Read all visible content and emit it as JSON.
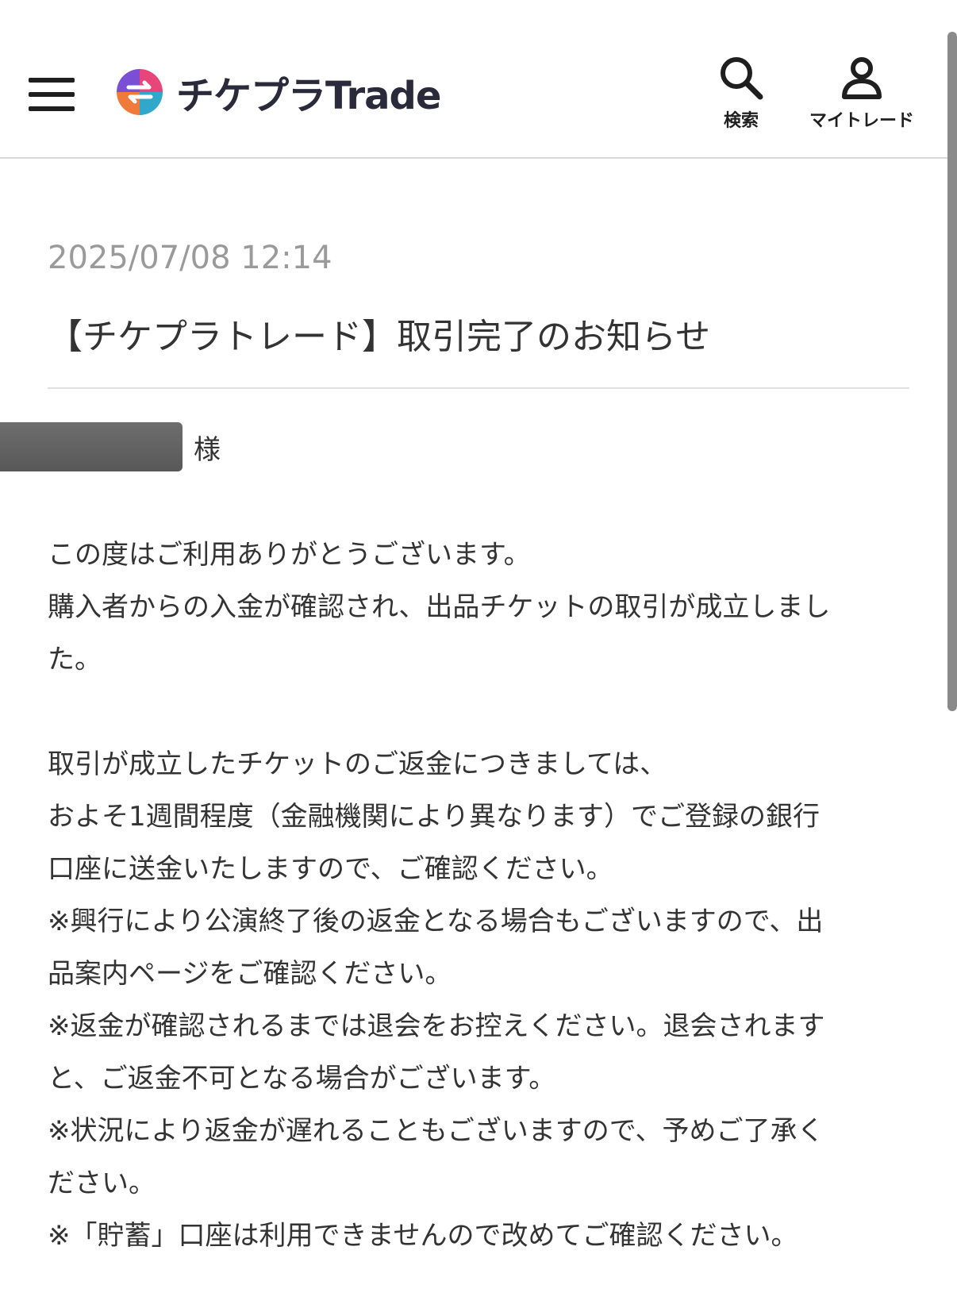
{
  "header": {
    "logo_text": "チケプラTrade",
    "search_label": "検索",
    "mytrade_label": "マイトレード"
  },
  "message": {
    "date": "2025/07/08 12:14",
    "subject": "【チケプラトレード】取引完了のお知らせ",
    "honorific": "様",
    "lines": [
      "この度はご利用ありがとうございます。",
      "購入者からの入金が確認され、出品チケットの取引が成立しまし",
      "た。",
      "",
      "取引が成立したチケットのご返金につきましては、",
      "およそ1週間程度（金融機関により異なります）でご登録の銀行",
      "口座に送金いたしますので、ご確認ください。",
      "※興行により公演終了後の返金となる場合もございますので、出",
      "品案内ページをご確認ください。",
      "※返金が確認されるまでは退会をお控えください。退会されます",
      "と、ご返金不可となる場合がございます。",
      "※状況により返金が遅れることもございますので、予めご了承く",
      "ださい。",
      "※「貯蓄」口座は利用できませんので改めてご確認ください。"
    ]
  },
  "colors": {
    "text": "#333333",
    "date": "#9a9a9a",
    "divider": "#e0e0e0",
    "logo_text": "#2a2a3a"
  },
  "icons": [
    "menu-icon",
    "logo-mark-icon",
    "search-icon",
    "user-icon"
  ]
}
